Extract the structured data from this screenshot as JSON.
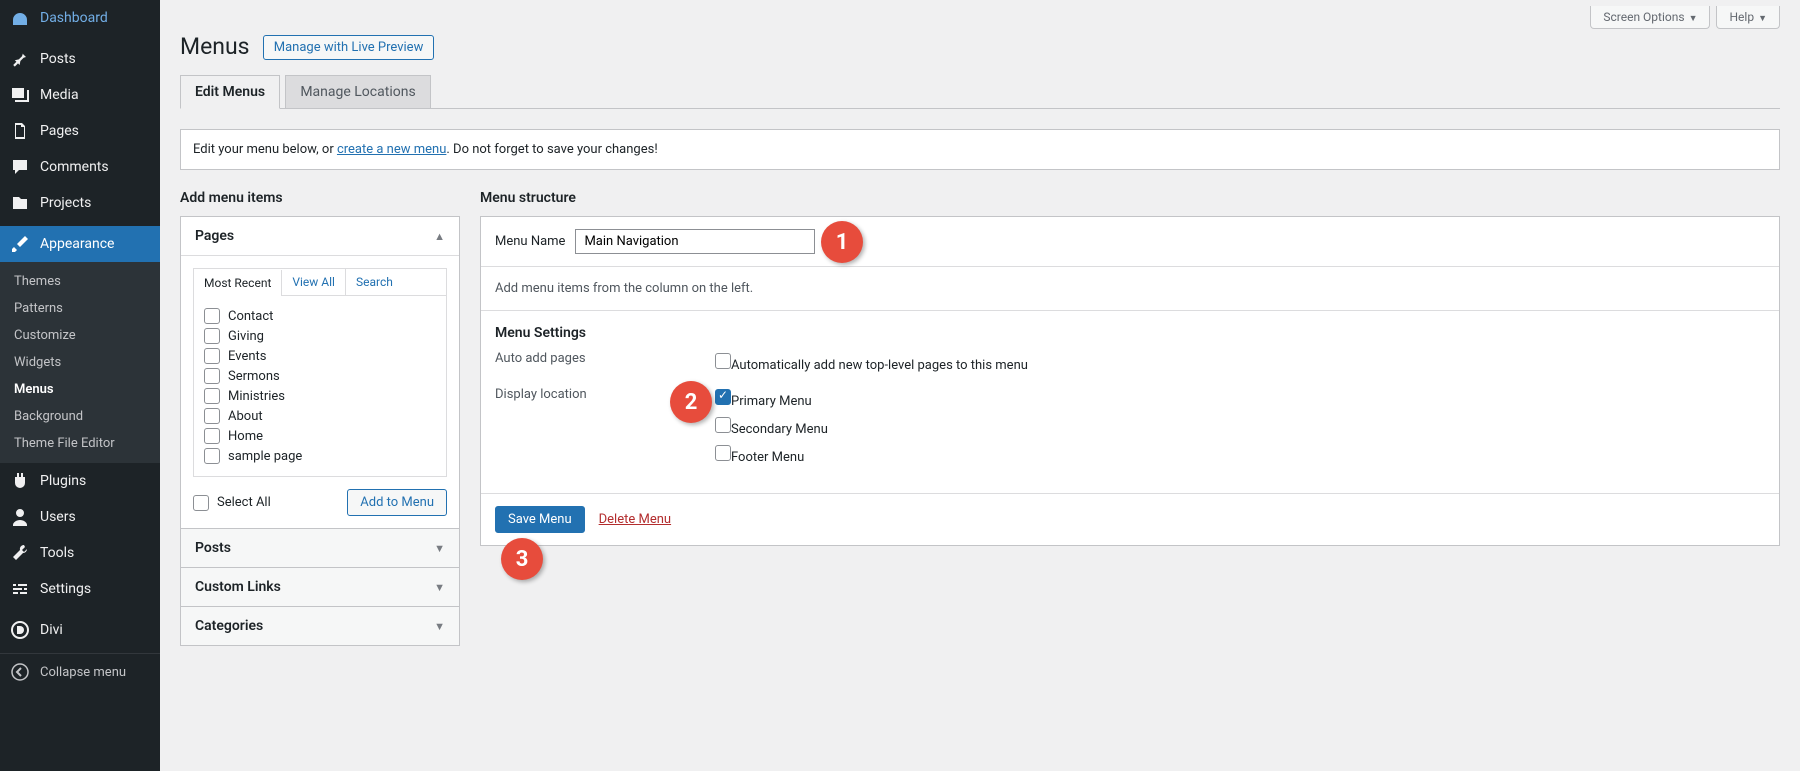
{
  "screen_options": "Screen Options",
  "help": "Help",
  "page_title": "Menus",
  "title_action": "Manage with Live Preview",
  "tabs": {
    "edit": "Edit Menus",
    "locations": "Manage Locations"
  },
  "notice_prefix": "Edit your menu below, or ",
  "notice_link": "create a new menu",
  "notice_suffix": ". Do not forget to save your changes!",
  "left_heading": "Add menu items",
  "right_heading": "Menu structure",
  "accordions": {
    "pages": "Pages",
    "posts": "Posts",
    "custom_links": "Custom Links",
    "categories": "Categories"
  },
  "inner_tabs": {
    "recent": "Most Recent",
    "all": "View All",
    "search": "Search"
  },
  "page_items": [
    "Contact",
    "Giving",
    "Events",
    "Sermons",
    "Ministries",
    "About",
    "Home",
    "sample page"
  ],
  "select_all": "Select All",
  "add_to_menu": "Add to Menu",
  "menu_name_label": "Menu Name",
  "menu_name_value": "Main Navigation",
  "empty_msg": "Add menu items from the column on the left.",
  "settings_heading": "Menu Settings",
  "auto_add_label": "Auto add pages",
  "auto_add_option": "Automatically add new top-level pages to this menu",
  "display_loc_label": "Display location",
  "locations": {
    "primary": "Primary Menu",
    "secondary": "Secondary Menu",
    "footer": "Footer Menu"
  },
  "save_menu": "Save Menu",
  "delete_menu": "Delete Menu",
  "sidebar": {
    "dashboard": "Dashboard",
    "posts": "Posts",
    "media": "Media",
    "pages": "Pages",
    "comments": "Comments",
    "projects": "Projects",
    "appearance": "Appearance",
    "plugins": "Plugins",
    "users": "Users",
    "tools": "Tools",
    "settings": "Settings",
    "divi": "Divi",
    "collapse": "Collapse menu"
  },
  "submenu": {
    "themes": "Themes",
    "patterns": "Patterns",
    "customize": "Customize",
    "widgets": "Widgets",
    "menus": "Menus",
    "background": "Background",
    "editor": "Theme File Editor"
  },
  "annotations": {
    "a1": "1",
    "a2": "2",
    "a3": "3"
  }
}
